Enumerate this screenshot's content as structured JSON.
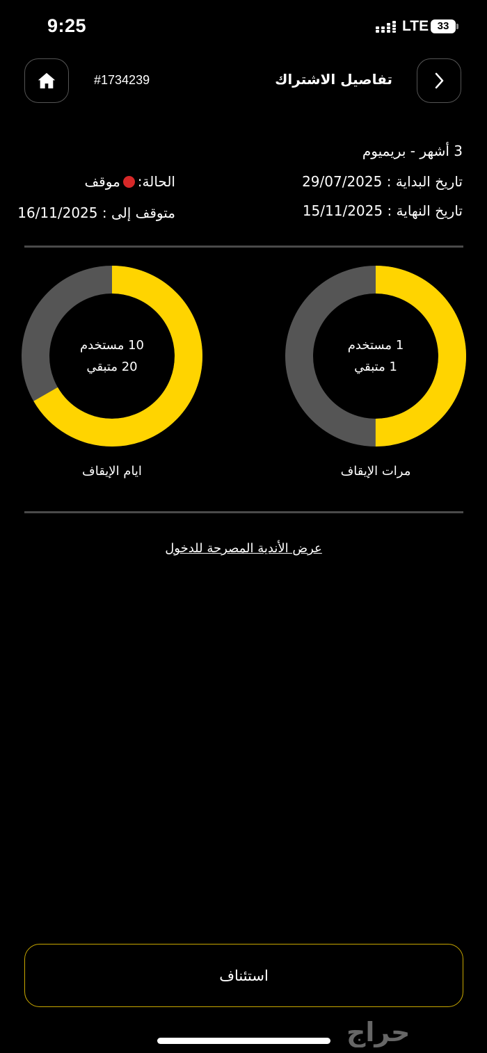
{
  "status_bar": {
    "time": "9:25",
    "network": "LTE",
    "battery": "33",
    "battery_level": 0.33
  },
  "header": {
    "title": "تفاصيل الاشتراك",
    "subscription_id": "#1734239"
  },
  "info": {
    "plan": "3 أشهر - بريميوم",
    "start_date": "تاريخ البداية : 29/07/2025",
    "end_date": "تاريخ النهاية : 15/11/2025",
    "status_label": "الحالة:",
    "status_value": "موقف",
    "paused_until": "متوقف إلى : 16/11/2025"
  },
  "stats": {
    "freeze_days": {
      "used": "10 مستخدم",
      "remaining": "20 متبقي",
      "label": "ايام الإيقاف",
      "used_value": 10,
      "remaining_value": 20
    },
    "freeze_times": {
      "used": "1 مستخدم",
      "remaining": "1 متبقي",
      "label": "مرات الإيقاف",
      "used_value": 1,
      "remaining_value": 1
    }
  },
  "links": {
    "view_clubs": "عرض الأندية المصرحة للدخول"
  },
  "actions": {
    "resume": "استئناف"
  },
  "watermark": "حراج",
  "colors": {
    "accent": "#FFD400",
    "ring_track": "#555555",
    "status_dot": "#D62828",
    "background": "#000000"
  }
}
